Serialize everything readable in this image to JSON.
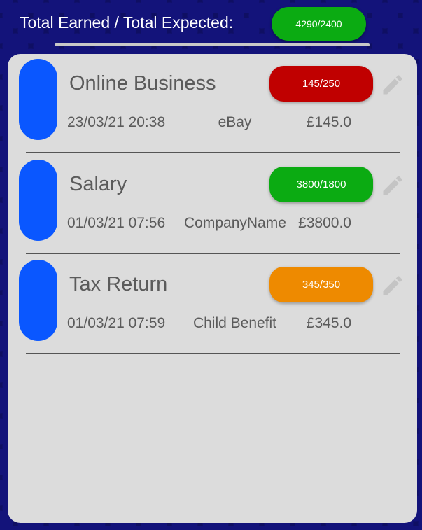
{
  "header": {
    "title": "Total Earned / Total Expected:",
    "total_badge": "4290/2400",
    "total_badge_color": "#0bab12"
  },
  "items": [
    {
      "name": "Online Business",
      "badge": "145/250",
      "badge_color": "#c00000",
      "date": "23/03/21 20:38",
      "source": "eBay",
      "amount": "£145.0",
      "icon": "pencil-icon"
    },
    {
      "name": "Salary",
      "badge": "3800/1800",
      "badge_color": "#0bab12",
      "date": "01/03/21 07:56",
      "source": "CompanyName",
      "amount": "£3800.0",
      "icon": "pencil-icon"
    },
    {
      "name": "Tax Return",
      "badge": "345/350",
      "badge_color": "#ee8a00",
      "date": "01/03/21 07:59",
      "source": "Child Benefit",
      "amount": "£345.0",
      "icon": "pencil-icon"
    }
  ],
  "colors": {
    "background": "#0f0f63",
    "card": "#dcdcdc",
    "pill": "#0a57ff",
    "text": "#5b5b5b"
  }
}
